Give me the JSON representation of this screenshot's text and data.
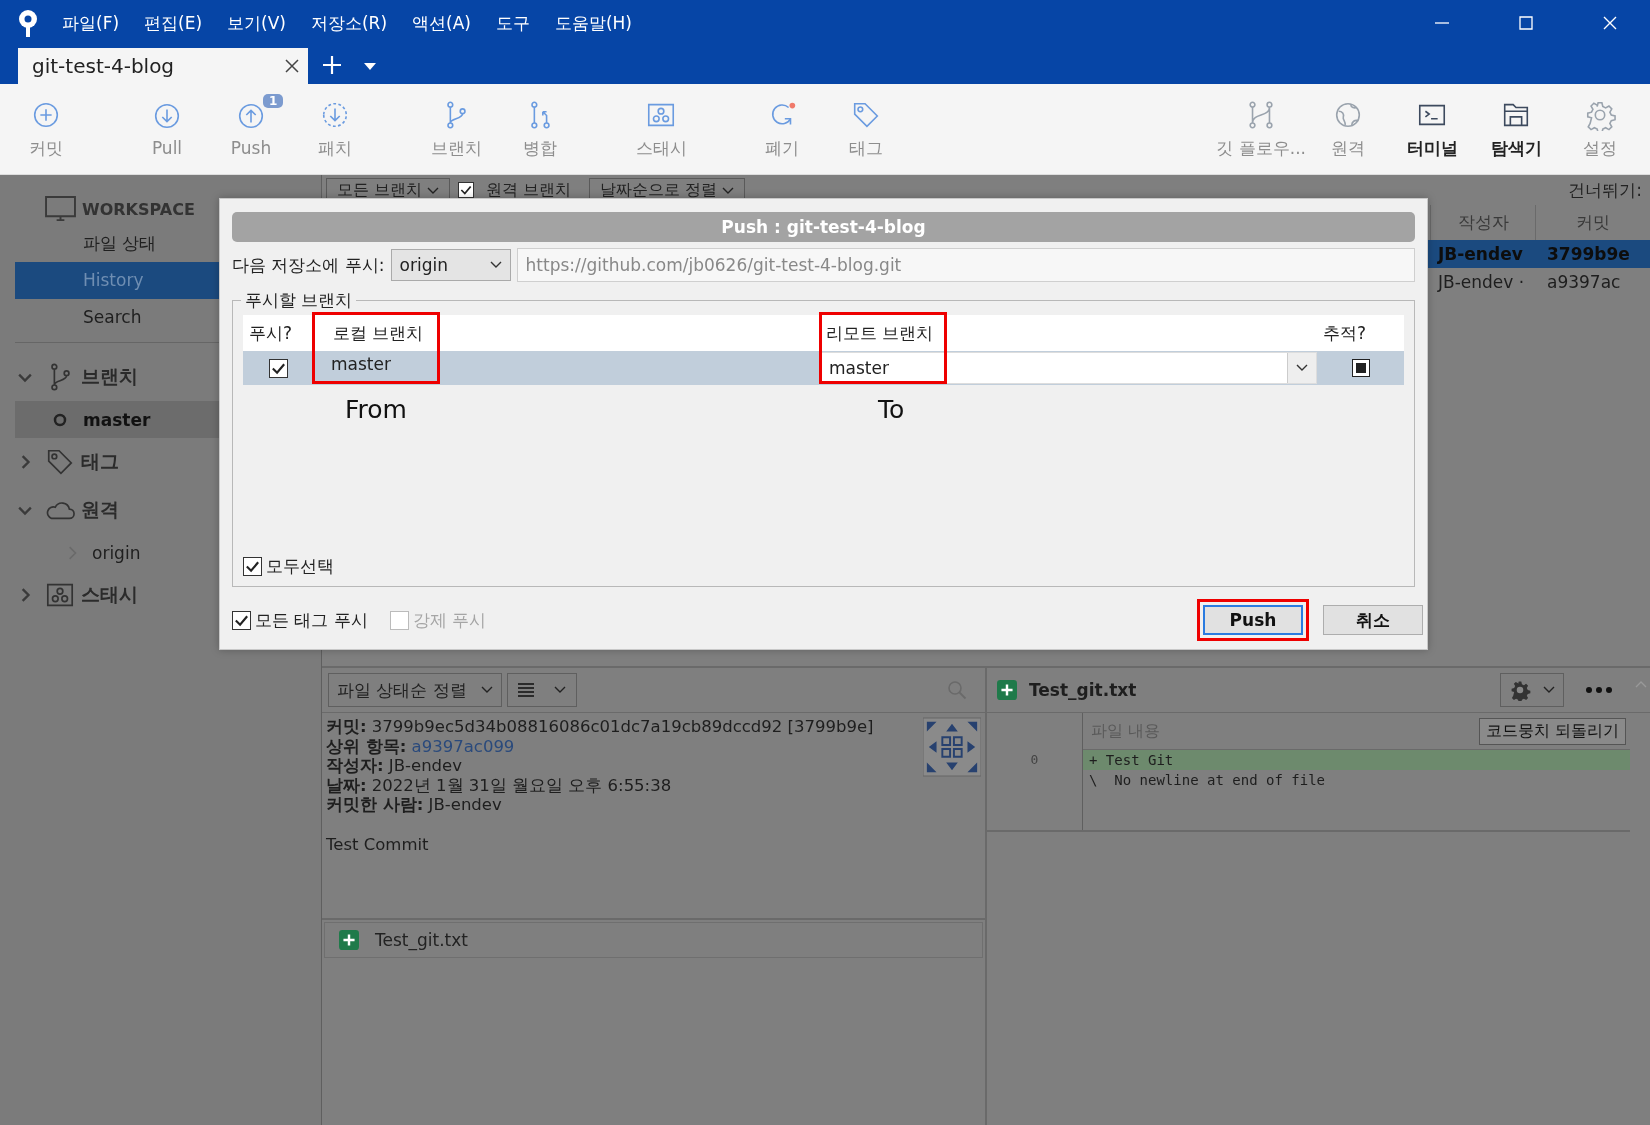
{
  "menu": [
    "파일(F)",
    "편집(E)",
    "보기(V)",
    "저장소(R)",
    "액션(A)",
    "도구",
    "도움말(H)"
  ],
  "tabs": [
    {
      "label": "git-test-4-blog",
      "selected": true
    }
  ],
  "toolbar": [
    {
      "label": "커밋",
      "emphasized": false
    },
    {
      "label": "Pull",
      "emphasized": false
    },
    {
      "label": "Push",
      "emphasized": false,
      "badge": "1"
    },
    {
      "label": "패치",
      "emphasized": false
    },
    {
      "label": "브랜치",
      "emphasized": false
    },
    {
      "label": "병합",
      "emphasized": false
    },
    {
      "label": "스태시",
      "emphasized": false
    },
    {
      "label": "폐기",
      "emphasized": false
    },
    {
      "label": "태그",
      "emphasized": false
    },
    {
      "label": "깃 플로우...",
      "emphasized": false
    },
    {
      "label": "원격",
      "emphasized": false
    },
    {
      "label": "터미널",
      "emphasized": true
    },
    {
      "label": "탐색기",
      "emphasized": true
    },
    {
      "label": "설정",
      "emphasized": false
    }
  ],
  "sidebar": {
    "workspace": {
      "title": "WORKSPACE",
      "items": [
        {
          "label": "파일 상태",
          "selected": false
        },
        {
          "label": "History",
          "selected": true
        },
        {
          "label": "Search",
          "selected": false
        }
      ]
    },
    "groups": [
      {
        "label": "브랜치",
        "expanded": true,
        "children": [
          {
            "label": "master",
            "current": true
          }
        ]
      },
      {
        "label": "태그",
        "expanded": false
      },
      {
        "label": "원격",
        "expanded": true,
        "children": [
          {
            "label": "origin",
            "expanded": false
          }
        ]
      },
      {
        "label": "스태시",
        "expanded": false
      }
    ]
  },
  "history": {
    "filters": [
      {
        "label": "모든 브랜치",
        "kind": "dropdown"
      },
      {
        "label": "원격 브랜치",
        "kind": "checkbox",
        "checked": true
      },
      {
        "label": "날짜순으로 정렬",
        "kind": "dropdown"
      }
    ],
    "jump_label": "건너뛰기:",
    "columns": [
      "작성자",
      "커밋"
    ],
    "rows": [
      {
        "author": "JB-endev",
        "commit": "3799b9e",
        "selected": true
      },
      {
        "author": "JB-endev ·",
        "commit": "a9397ac",
        "selected": false
      }
    ]
  },
  "dialog": {
    "title": "Push : git-test-4-blog",
    "repo_label": "다음 저장소에 푸시:",
    "remote": "origin",
    "url": "https://github.com/jb0626/git-test-4-blog.git",
    "group_label": "푸시할 브랜치",
    "columns": [
      {
        "label": "푸시?",
        "highlighted": false
      },
      {
        "label": "로컬 브랜치",
        "highlighted": true
      },
      {
        "label": "리모트 브랜치",
        "highlighted": true
      },
      {
        "label": "추적?",
        "highlighted": false
      }
    ],
    "branches": [
      {
        "push": true,
        "local": "master",
        "remote": "master",
        "track": true,
        "selected": true
      }
    ],
    "annotations": [
      "From",
      "To"
    ],
    "select_all": {
      "label": "모두선택",
      "checked": true
    },
    "options": [
      {
        "label": "모든 태그 푸시",
        "checked": true,
        "disabled": false
      },
      {
        "label": "강제 푸시",
        "checked": false,
        "disabled": true
      }
    ],
    "buttons": [
      {
        "label": "Push",
        "kind": "primary",
        "highlighted": true
      },
      {
        "label": "취소",
        "kind": "secondary",
        "highlighted": false
      }
    ]
  },
  "details": {
    "sort_label": "파일 상태순 정렬",
    "fields": [
      {
        "label": "커밋:",
        "value": "3799b9ec5d34b08816086c01dc7a19cb89dccd92 [3799b9e]",
        "kind": "text"
      },
      {
        "label": "상위 항목:",
        "value": "a9397ac099",
        "kind": "link"
      },
      {
        "label": "작성자:",
        "value": "JB-endev",
        "kind": "text"
      },
      {
        "label": "날짜:",
        "value": "2022년 1월 31일 월요일 오후 6:55:38",
        "kind": "text"
      },
      {
        "label": "커밋한 사람:",
        "value": "JB-endev",
        "kind": "text"
      }
    ],
    "message": "Test Commit",
    "files": [
      {
        "name": "Test_git.txt",
        "kind": "added"
      }
    ]
  },
  "diff": {
    "file": "Test_git.txt",
    "kind": "added",
    "header": "파일 내용",
    "revert_label": "코드뭉치 되돌리기",
    "lines": [
      {
        "number": "0",
        "text": "+ Test Git",
        "kind": "added"
      },
      {
        "text": "\\  No newline at end of file",
        "kind": "context"
      }
    ]
  }
}
